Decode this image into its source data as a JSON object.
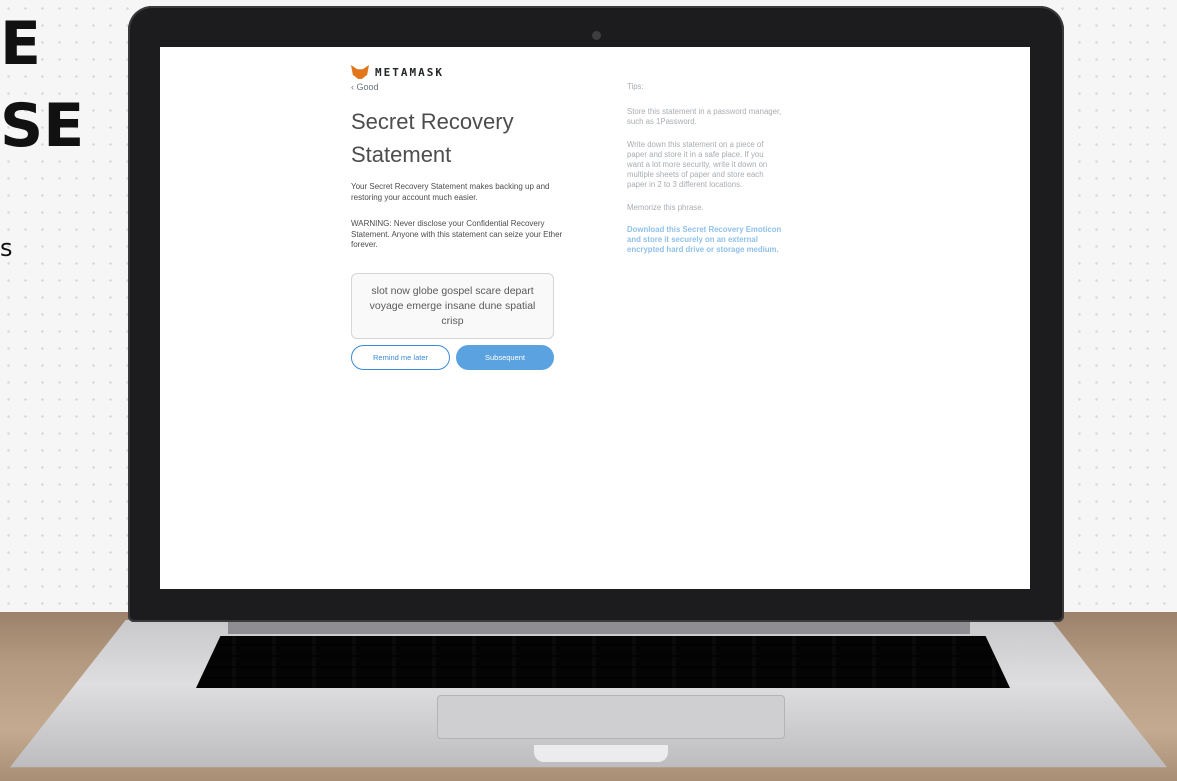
{
  "background": {
    "headline_line1": "E",
    "headline_line2": "SE",
    "fragment": "s"
  },
  "app": {
    "brand": "METAMASK",
    "brand_icon": "fox-icon",
    "back_label": "‹ Good",
    "title": "Secret Recovery Statement",
    "intro": "Your Secret Recovery Statement makes backing up and restoring your account much easier.",
    "warning": "WARNING: Never disclose your Confidential Recovery Statement. Anyone with this statement can seize your Ether forever.",
    "phrase": "slot now globe gospel scare depart voyage emerge insane dune spatial crisp",
    "remind_label": "Remind me later",
    "next_label": "Subsequent"
  },
  "tips": {
    "heading": "Tips:",
    "items": [
      "Store this statement in a password manager, such as 1Password.",
      "Write down this statement on a piece of paper and store it in a safe place. If you want a lot more security, write it down on multiple sheets of paper and store each paper in 2 to 3 different locations.",
      "Memorize this phrase."
    ],
    "download_link": "Download this Secret Recovery Emoticon and store it securely on an external encrypted hard drive or storage medium."
  },
  "colors": {
    "accent": "#3a8bd6",
    "primary_button": "#5aa2e0",
    "fox": "#e2761b"
  }
}
